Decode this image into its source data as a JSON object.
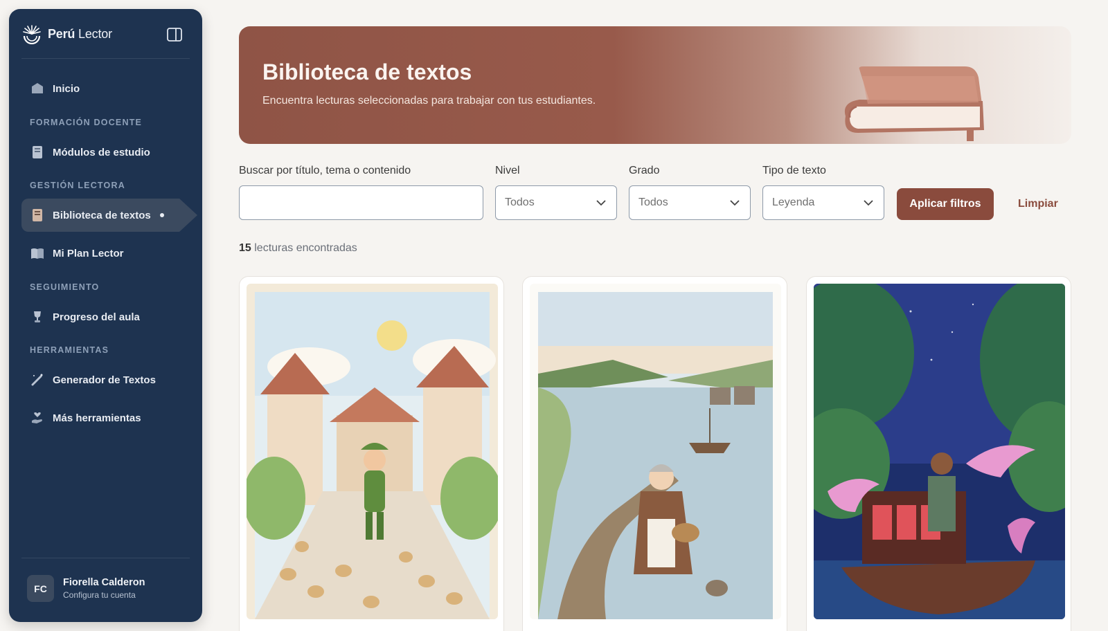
{
  "brand": {
    "bold": "Perú",
    "light": "Lector"
  },
  "sidebar": {
    "home": "Inicio",
    "sections": [
      {
        "title": "FORMACIÓN DOCENTE",
        "items": [
          "Módulos de estudio"
        ]
      },
      {
        "title": "GESTIÓN LECTORA",
        "items": [
          "Biblioteca de textos",
          "Mi Plan Lector"
        ]
      },
      {
        "title": "SEGUIMIENTO",
        "items": [
          "Progreso del aula"
        ]
      },
      {
        "title": "HERRAMIENTAS",
        "items": [
          "Generador de Textos",
          "Más herramientas"
        ]
      }
    ],
    "active_item": "Biblioteca de textos"
  },
  "user": {
    "initials": "FC",
    "name": "Fiorella Calderon",
    "subtitle": "Configura tu cuenta"
  },
  "hero": {
    "title": "Biblioteca de textos",
    "subtitle": "Encuentra lecturas seleccionadas para trabajar con tus estudiantes."
  },
  "filters": {
    "search_label": "Buscar por título, tema o contenido",
    "search_value": "",
    "nivel_label": "Nivel",
    "nivel_value": "Todos",
    "grado_label": "Grado",
    "grado_value": "Todos",
    "tipo_label": "Tipo de texto",
    "tipo_value": "Leyenda",
    "apply": "Aplicar filtros",
    "clear": "Limpiar"
  },
  "results": {
    "count": "15",
    "label": "lecturas encontradas"
  },
  "cards": [
    {
      "image": "flute-player-village-illustration"
    },
    {
      "image": "grandmother-lake-pier-illustration"
    },
    {
      "image": "river-boat-pink-dolphins-illustration"
    }
  ],
  "colors": {
    "sidebar": "#1e3350",
    "accent": "#8a4b3d",
    "background": "#f6f4f1"
  }
}
